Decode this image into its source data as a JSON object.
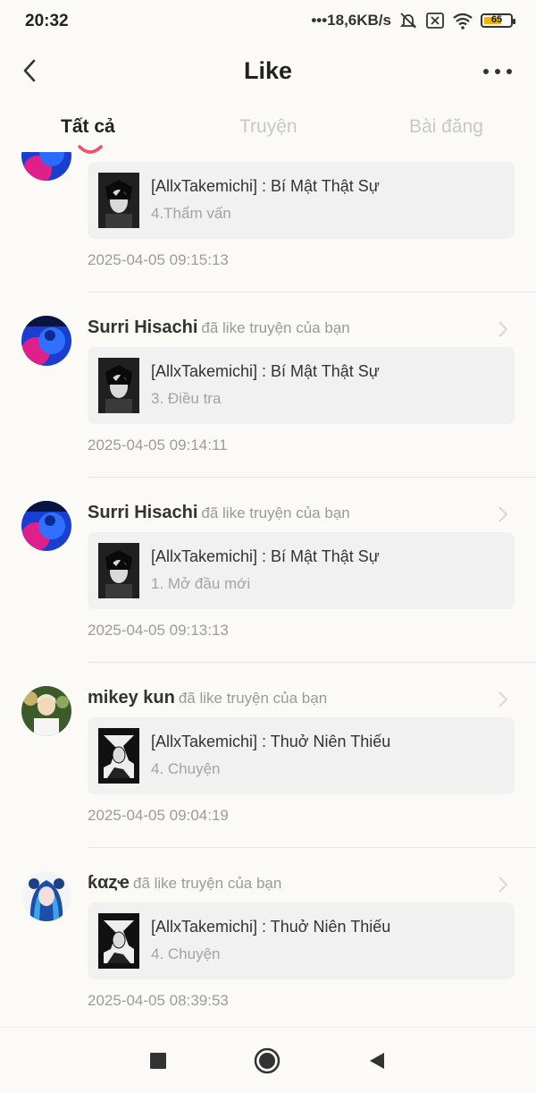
{
  "status_bar": {
    "time": "20:32",
    "network_speed": "•••18,6KB/s",
    "battery": "65"
  },
  "header": {
    "title": "Like",
    "back_icon": "chevron-left-icon",
    "more_icon": "more-horizontal-icon"
  },
  "tabs": [
    {
      "label": "Tất cả",
      "active": true
    },
    {
      "label": "Truyện",
      "active": false
    },
    {
      "label": "Bài đăng",
      "active": false
    }
  ],
  "notifications": [
    {
      "user": "",
      "action": "",
      "book": "[AllxTakemichi] : Bí Mật Thật Sự",
      "chapter": "4.Thẩm vấn",
      "time": "2025-04-05 09:15:13"
    },
    {
      "user": "Surri Hisachi",
      "action": "đã like truyện của bạn",
      "book": "[AllxTakemichi] : Bí Mật Thật Sự",
      "chapter": "3. Điều tra",
      "time": "2025-04-05 09:14:11"
    },
    {
      "user": "Surri Hisachi",
      "action": "đã like truyện của bạn",
      "book": "[AllxTakemichi] : Bí Mật Thật Sự",
      "chapter": "1. Mở đầu mới",
      "time": "2025-04-05 09:13:13"
    },
    {
      "user": "mikey kun",
      "action": "đã like truyện của bạn",
      "book": "[AllxTakemichi] : Thuở Niên Thiếu",
      "chapter": "4. Chuyện",
      "time": "2025-04-05 09:04:19"
    },
    {
      "user": "ƙαȥҽ",
      "action": "đã like truyện của bạn",
      "book": "[AllxTakemichi] : Thuở Niên Thiếu",
      "chapter": "4. Chuyện",
      "time": "2025-04-05 08:39:53"
    }
  ],
  "nav": {
    "recent_icon": "square-icon",
    "home_icon": "circle-home-icon",
    "back_icon": "triangle-back-icon"
  },
  "colors": {
    "accent": "#f0506e",
    "background": "#fbfaf7",
    "card": "#f1f1f1"
  }
}
